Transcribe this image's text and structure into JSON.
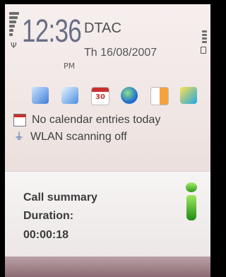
{
  "status_bar": {
    "time": "12:36",
    "ampm": "PM",
    "operator": "DTAC",
    "date": "Th 16/08/2007"
  },
  "shortcuts": [
    {
      "name": "contacts-icon"
    },
    {
      "name": "messaging-icon"
    },
    {
      "name": "calendar-icon",
      "label": "30"
    },
    {
      "name": "web-icon"
    },
    {
      "name": "media-icon"
    },
    {
      "name": "gallery-icon"
    }
  ],
  "info": {
    "calendar_text": "No calendar entries today",
    "wlan_text": "WLAN scanning off"
  },
  "dialog": {
    "title": "Call summary",
    "label": "Duration:",
    "value": "00:00:18"
  },
  "colors": {
    "clock": "#6a6f86",
    "accent_green": "#2c9a1a"
  }
}
